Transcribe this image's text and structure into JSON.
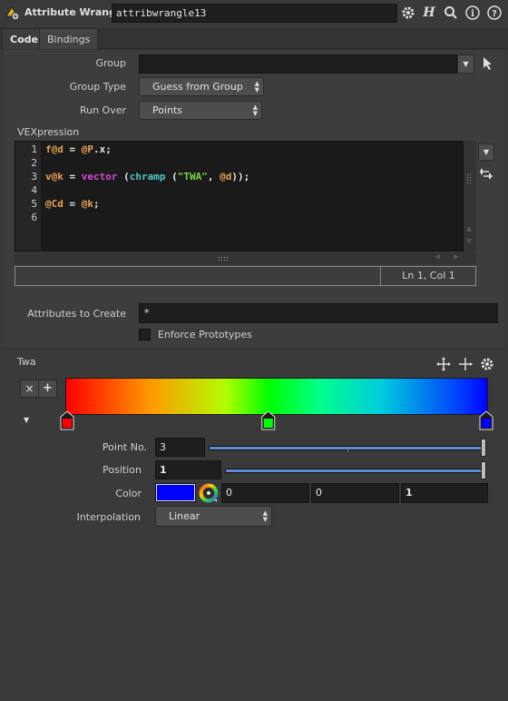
{
  "header": {
    "node_type": "Attribute Wrangle",
    "node_name": "attribwrangle13",
    "icons": [
      "gear-icon",
      "help-h-icon",
      "search-icon",
      "info-icon",
      "question-icon"
    ]
  },
  "tabs": [
    {
      "label": "Code",
      "active": true
    },
    {
      "label": "Bindings",
      "active": false
    }
  ],
  "params": {
    "group_label": "Group",
    "group_value": "",
    "group_type_label": "Group Type",
    "group_type_value": "Guess from Group",
    "run_over_label": "Run Over",
    "run_over_value": "Points",
    "vexpression_label": "VEXpression",
    "attributes_label": "Attributes to Create",
    "attributes_value": "*",
    "enforce_label": "Enforce Prototypes",
    "enforce_checked": false
  },
  "code": {
    "line_numbers": [
      "1",
      "2",
      "3",
      "4",
      "5",
      "6"
    ],
    "line1": {
      "a": "f@d",
      "b": " = ",
      "c": "@P",
      "d": ".x;"
    },
    "line3": {
      "a": "v@k",
      "b": " = ",
      "c": "vector",
      "d": " (",
      "e": "chramp",
      "f": " (",
      "g": "\"TWA\"",
      "h": ", ",
      "i": "@d",
      "j": "));"
    },
    "line5": {
      "a": "@Cd",
      "b": " = ",
      "c": "@k",
      "d": ";"
    },
    "status": "Ln 1, Col 1"
  },
  "ramp": {
    "label": "Twa",
    "delete_label": "×",
    "add_label": "+",
    "point_no_label": "Point No.",
    "point_no_value": "3",
    "point_no_fraction": 1.0,
    "position_label": "Position",
    "position_value": "1",
    "position_fraction": 1.0,
    "color_label": "Color",
    "color_swatch": "#0000ff",
    "color_r": "0",
    "color_g": "0",
    "color_b": "1",
    "interpolation_label": "Interpolation",
    "interpolation_value": "Linear",
    "keys": [
      {
        "position": 0.0,
        "color": "#ff0000"
      },
      {
        "position": 0.48,
        "color": "#00ff00"
      },
      {
        "position": 1.0,
        "color": "#0000ff"
      }
    ]
  }
}
